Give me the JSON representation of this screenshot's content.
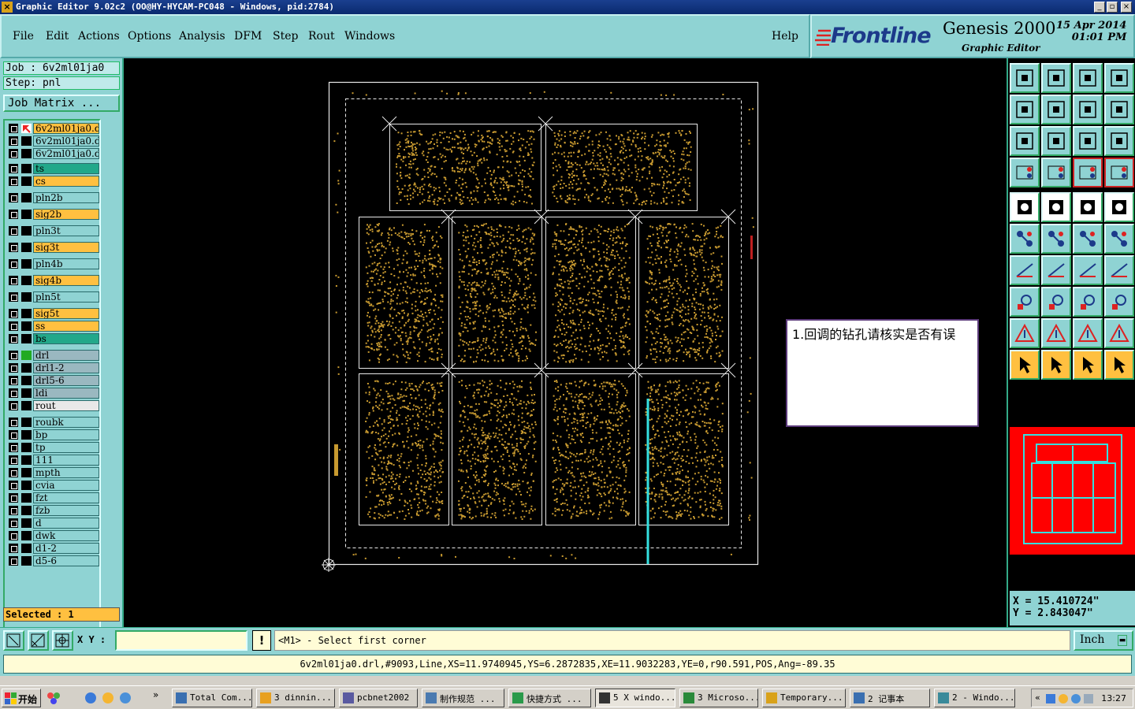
{
  "window": {
    "title": "Graphic Editor 9.02c2 (OO@HY-HYCAM-PC048 - Windows, pid:2784)"
  },
  "menu": {
    "items": [
      "File",
      "Edit",
      "Actions",
      "Options",
      "Analysis",
      "DFM",
      "Step",
      "Rout",
      "Windows"
    ],
    "help": "Help"
  },
  "brand": {
    "logo": "Frontline",
    "product": "Genesis 2000",
    "subtitle": "Graphic Editor",
    "date": "15 Apr 2014",
    "time": "01:01 PM"
  },
  "job": {
    "job_line": "Job : 6v2ml01ja0",
    "step_line": "Step: pnl",
    "matrix_button": "Job Matrix ..."
  },
  "layers": [
    {
      "name": "6v2ml01ja0.d",
      "color": "#ffc040",
      "active": true
    },
    {
      "name": "6v2ml01ja0.d",
      "color": "#8fd3d3"
    },
    {
      "name": "6v2ml01ja0.d",
      "color": "#8fd3d3"
    },
    {
      "name": "ts",
      "color": "#22a88a"
    },
    {
      "name": "cs",
      "color": "#ffc040"
    },
    {
      "name": "pln2b",
      "color": "#8fd3d3"
    },
    {
      "name": "sig2b",
      "color": "#ffc040"
    },
    {
      "name": "pln3t",
      "color": "#8fd3d3"
    },
    {
      "name": "sig3t",
      "color": "#ffc040"
    },
    {
      "name": "pln4b",
      "color": "#8fd3d3"
    },
    {
      "name": "sig4b",
      "color": "#ffc040"
    },
    {
      "name": "pln5t",
      "color": "#8fd3d3"
    },
    {
      "name": "sig5t",
      "color": "#ffc040"
    },
    {
      "name": "ss",
      "color": "#ffc040"
    },
    {
      "name": "bs",
      "color": "#22a88a"
    },
    {
      "name": "drl",
      "color": "#9ab8c0",
      "marker": "#22aa22"
    },
    {
      "name": "drl1-2",
      "color": "#9ab8c0"
    },
    {
      "name": "drl5-6",
      "color": "#9ab8c0"
    },
    {
      "name": "ldi",
      "color": "#9ab8c0"
    },
    {
      "name": "rout",
      "color": "#e8e8e8"
    },
    {
      "name": "roubk",
      "color": "#8fd3d3"
    },
    {
      "name": "bp",
      "color": "#8fd3d3"
    },
    {
      "name": "tp",
      "color": "#8fd3d3"
    },
    {
      "name": "111",
      "color": "#8fd3d3"
    },
    {
      "name": "mpth",
      "color": "#8fd3d3"
    },
    {
      "name": "cvia",
      "color": "#8fd3d3"
    },
    {
      "name": "fzt",
      "color": "#8fd3d3"
    },
    {
      "name": "fzb",
      "color": "#8fd3d3"
    },
    {
      "name": "d",
      "color": "#8fd3d3"
    },
    {
      "name": "dwk",
      "color": "#8fd3d3"
    },
    {
      "name": "d1-2",
      "color": "#8fd3d3"
    },
    {
      "name": "d5-6",
      "color": "#8fd3d3"
    }
  ],
  "selected": "Selected : 1",
  "note": "1.回调的钻孔请核实是否有误",
  "coords": {
    "x": "X = 15.410724\"",
    "y": "Y = 2.843047\""
  },
  "command": {
    "xy_label": "X Y :",
    "xy_value": "",
    "prompt": "<M1> - Select first corner",
    "units": "Inch"
  },
  "status_line": "6v2ml01ja0.drl,#9093,Line,XS=11.9740945,YS=6.2872835,XE=11.9032283,YE=0,r90.591,POS,Ang=-89.35",
  "taskbar": {
    "start": "开始",
    "tasks": [
      {
        "label": "Total Com...",
        "icon": "total-commander-icon"
      },
      {
        "label": "3 dinnin...",
        "icon": "star-icon"
      },
      {
        "label": "pcbnet2002",
        "icon": "globe-icon"
      },
      {
        "label": "制作规范 ...",
        "icon": "document-icon"
      },
      {
        "label": "快捷方式 ...",
        "icon": "shortcut-icon"
      },
      {
        "label": "5 X windo...",
        "icon": "x-window-icon",
        "active": true
      },
      {
        "label": "3 Microso...",
        "icon": "excel-icon"
      },
      {
        "label": "Temporary...",
        "icon": "folder-icon"
      },
      {
        "label": "2 记事本",
        "icon": "notepad-icon"
      },
      {
        "label": "2 - Windo...",
        "icon": "window-icon"
      }
    ],
    "clock": "13:27"
  }
}
